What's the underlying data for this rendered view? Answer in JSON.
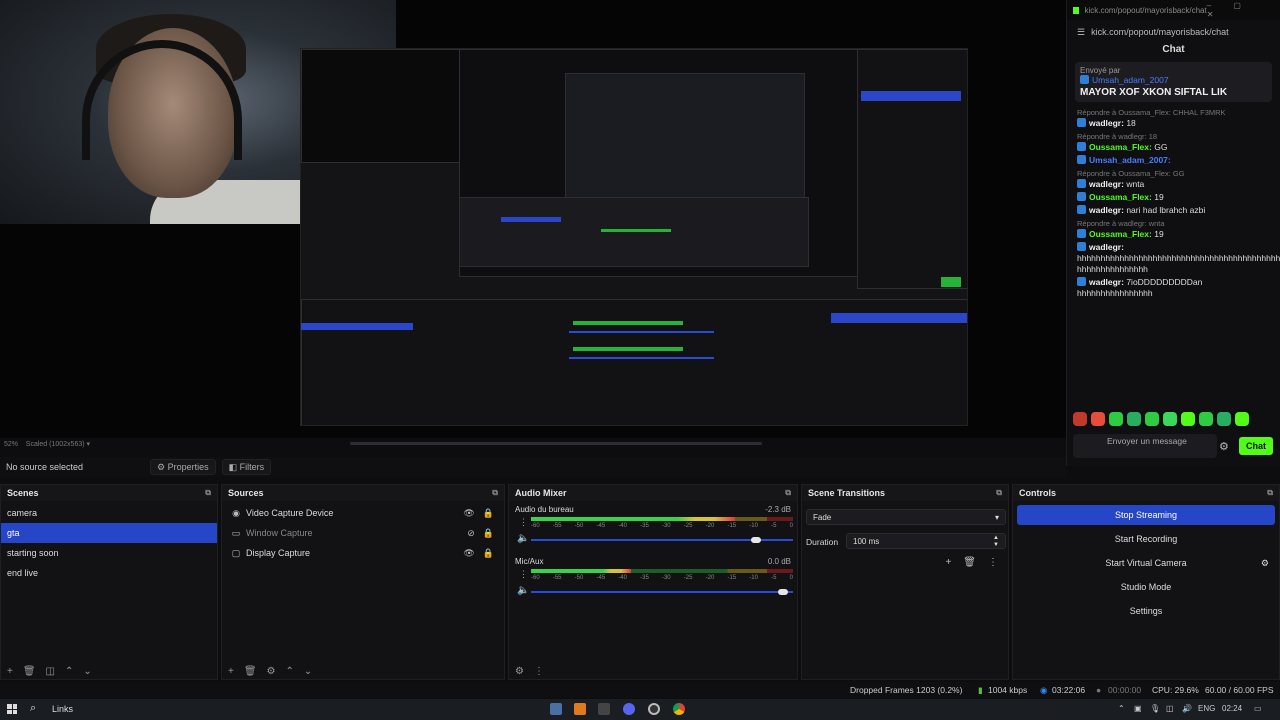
{
  "chat": {
    "tab_url": "kick.com/popout/mayorisback/chat",
    "url": "kick.com/popout/mayorisback/chat",
    "title": "Chat",
    "pinned_label": "Envoyé par",
    "pinned_user": "Umsah_adam_2007",
    "pinned_text": "MAYOR XOF XKON SIFTAL LIK",
    "messages": [
      {
        "reply": "Répondre à Oussama_Flex: CHHAL F3MRK",
        "user": "wadlegr:",
        "text": "18",
        "color": "w"
      },
      {
        "reply": "Répondre à wadlegr: 18",
        "user": "Oussama_Flex:",
        "text": "GG",
        "color": "g"
      },
      {
        "reply": "",
        "user": "Umsah_adam_2007:",
        "text": "",
        "color": "b"
      },
      {
        "reply": "Répondre à Oussama_Flex: GG",
        "user": "wadlegr:",
        "text": "wnta",
        "color": "w"
      },
      {
        "reply": "",
        "user": "Oussama_Flex:",
        "text": "19",
        "color": "g"
      },
      {
        "reply": "",
        "user": "wadlegr:",
        "text": "nari had lbrahch azbi",
        "color": "w"
      },
      {
        "reply": "Répondre à wadlegr: wnta",
        "user": "Oussama_Flex:",
        "text": "19",
        "color": "g"
      },
      {
        "reply": "",
        "user": "wadlegr:",
        "text": "hhhhhhhhhhhhhhhhhhhhhhhhhhhhhhhhhhhhhhhhhhhhhh hhhhhhhhhhhhhhh",
        "color": "w"
      },
      {
        "reply": "",
        "user": "wadlegr:",
        "text": "7ioDDDDDDDDDan hhhhhhhhhhhhhhhh",
        "color": "w"
      }
    ],
    "input_placeholder": "Envoyer un message",
    "send_label": "Chat",
    "emote_colors": [
      "#c0392b",
      "#e74c3c",
      "#2ecc40",
      "#27ae60",
      "#2ecc40",
      "#3bd65c",
      "#53fc18",
      "#2ecc40",
      "#27ae60",
      "#53fc18"
    ]
  },
  "preview": {
    "zoom_text": "52%",
    "scaled_text": "Scaled (1002x563)"
  },
  "toolbar": {
    "no_source": "No source selected",
    "properties": "Properties",
    "filters": "Filters"
  },
  "scenes": {
    "title": "Scenes",
    "items": [
      "camera",
      "gta",
      "starting soon",
      "end live"
    ],
    "active_index": 1
  },
  "sources": {
    "title": "Sources",
    "items": [
      "Video Capture Device",
      "Window Capture",
      "Display Capture"
    ]
  },
  "mixer": {
    "title": "Audio Mixer",
    "channels": [
      {
        "name": "Audio du bureau",
        "db": "-2.3 dB",
        "level": 0.78,
        "volume": 0.86
      },
      {
        "name": "Mic/Aux",
        "db": "0.0 dB",
        "level": 0.38,
        "volume": 0.96
      }
    ],
    "ticks": [
      "-60",
      "-55",
      "-50",
      "-45",
      "-40",
      "-35",
      "-30",
      "-25",
      "-20",
      "-15",
      "-10",
      "-5",
      "0"
    ]
  },
  "transitions": {
    "title": "Scene Transitions",
    "selected": "Fade",
    "duration_label": "Duration",
    "duration_value": "100 ms"
  },
  "controls": {
    "title": "Controls",
    "buttons": [
      "Stop Streaming",
      "Start Recording",
      "Start Virtual Camera",
      "Studio Mode",
      "Settings"
    ]
  },
  "status": {
    "dropped": "Dropped Frames 1203 (0.2%)",
    "bitrate": "1004 kbps",
    "live_time": "03:22:06",
    "rec_time": "00:00:00",
    "cpu": "CPU: 29.6%",
    "fps": "60.00 / 60.00 FPS"
  },
  "taskbar": {
    "search_label": "Links",
    "lang": "ENG",
    "clock": "02:24"
  }
}
